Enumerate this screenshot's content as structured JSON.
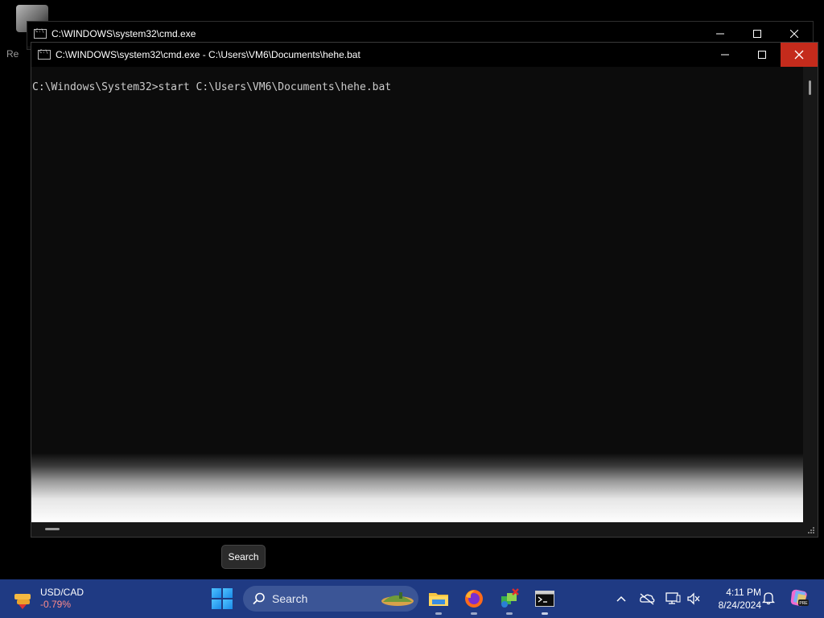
{
  "desktop": {
    "partial_text": "Re"
  },
  "back_window": {
    "title": "C:\\WINDOWS\\system32\\cmd.exe"
  },
  "front_window": {
    "title": "C:\\WINDOWS\\system32\\cmd.exe - C:\\Users\\VM6\\Documents\\hehe.bat",
    "console_line": "C:\\Windows\\System32>start C:\\Users\\VM6\\Documents\\hehe.bat"
  },
  "tooltip": {
    "text": "Search"
  },
  "taskbar": {
    "widget": {
      "line1": "USD/CAD",
      "line2": "-0.79%",
      "down_color": "#ff8b8b"
    },
    "search": {
      "label": "Search"
    },
    "apps": [
      "file-explorer",
      "firefox",
      "network-tool",
      "command-prompt"
    ],
    "clock": {
      "time": "4:11 PM",
      "date": "8/24/2024"
    }
  },
  "colors": {
    "taskbar": "#1f3a83",
    "close_hover": "#c42b1c",
    "console_bg": "#0c0c0c",
    "console_fg": "#cccccc"
  }
}
